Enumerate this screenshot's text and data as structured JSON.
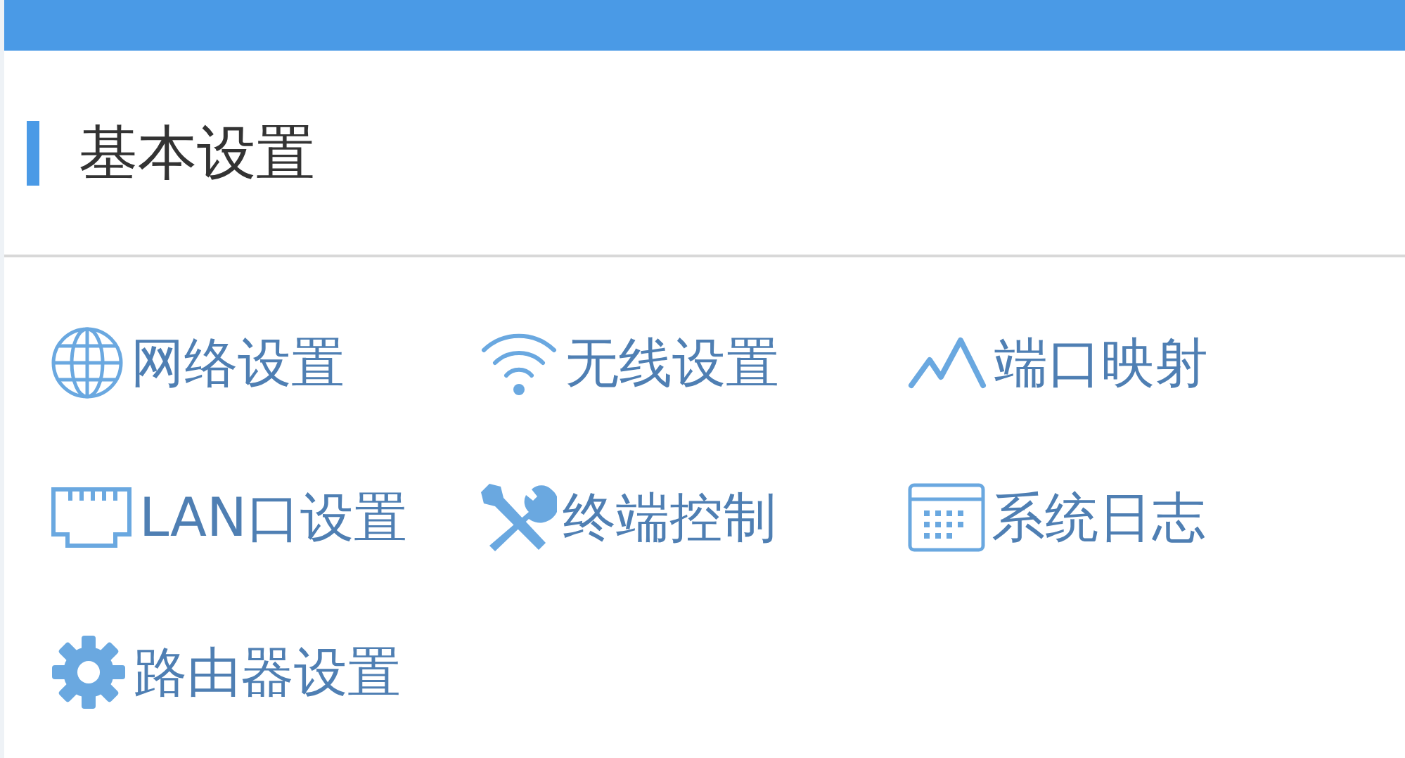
{
  "section": {
    "title": "基本设置"
  },
  "items": [
    {
      "label": "网络设置"
    },
    {
      "label": "无线设置"
    },
    {
      "label": "端口映射"
    },
    {
      "label": "LAN口设置"
    },
    {
      "label": "终端控制"
    },
    {
      "label": "系统日志"
    },
    {
      "label": "路由器设置"
    }
  ]
}
